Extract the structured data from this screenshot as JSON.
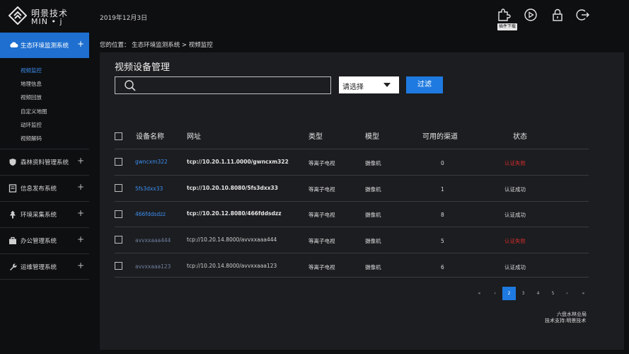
{
  "header": {
    "brand_name": "明景技术",
    "brand_sub": "MIN  •  j",
    "date": "2019年12月3日",
    "plugin_tooltip": "插件下载",
    "icons": [
      "plugin-icon",
      "play-icon",
      "lock-icon",
      "logout-icon"
    ]
  },
  "sidebar": {
    "active": {
      "label": "生态环境监测系统",
      "plus": "+"
    },
    "sub_items": [
      "视频监控",
      "地理信息",
      "视频回放",
      "自定义地图",
      "动环监控",
      "视频解码"
    ],
    "items": [
      {
        "label": "森林资料管理系统",
        "plus": "+"
      },
      {
        "label": "信息发布系统",
        "plus": "+"
      },
      {
        "label": "环境采集系统",
        "plus": "+"
      },
      {
        "label": "办公管理系统",
        "plus": "+"
      },
      {
        "label": "运维管理系统",
        "plus": "+"
      }
    ]
  },
  "breadcrumb": "您的位置：  生态环境监测系统 > 视频监控",
  "main": {
    "title": "视频设备管理",
    "search_placeholder": "",
    "select_value": "请选择",
    "filter_label": "过滤",
    "columns": [
      "设备名称",
      "网址",
      "类型",
      "模型",
      "可用的渠道",
      "状态"
    ],
    "rows": [
      {
        "name": "gwncxm322",
        "url": "tcp://10.20.1.11.0000/gwncxm322",
        "type": "等离子电视",
        "model": "摄像机",
        "channels": "0",
        "status": "认证失败"
      },
      {
        "name": "5fs3dxx33",
        "url": "tcp://10.20.10.8080/5fs3dxx33",
        "type": "等离子电视",
        "model": "摄像机",
        "channels": "1",
        "status": "认证成功"
      },
      {
        "name": "466fddsdzz",
        "url": "tcp://10.20.12.8080/466fddsdzz",
        "type": "等离子电视",
        "model": "摄像机",
        "channels": "8",
        "status": "认证成功"
      },
      {
        "name": "avvxxaaa444",
        "url": "tcp://10.20.14.8000/avvxxaaa444",
        "type": "等离子电视",
        "model": "摄像机",
        "channels": "5",
        "status": "认证失败"
      },
      {
        "name": "avvxxaaa123",
        "url": "tcp://10.20.14.8000/avvxxaaa123",
        "type": "等离子电视",
        "model": "摄像机",
        "channels": "6",
        "status": "认证成功"
      }
    ],
    "pagination": {
      "first": "«",
      "prev": "‹",
      "pages": [
        "2",
        "3",
        "4",
        "5"
      ],
      "current": "2",
      "next": "›",
      "last": "»"
    },
    "footer": {
      "line1": "六盘水林业局",
      "line2": "技术支持:明景技术"
    }
  },
  "colors": {
    "accent": "#1e7ae0",
    "fail": "#d22d2d",
    "link": "#3d8ef0"
  }
}
